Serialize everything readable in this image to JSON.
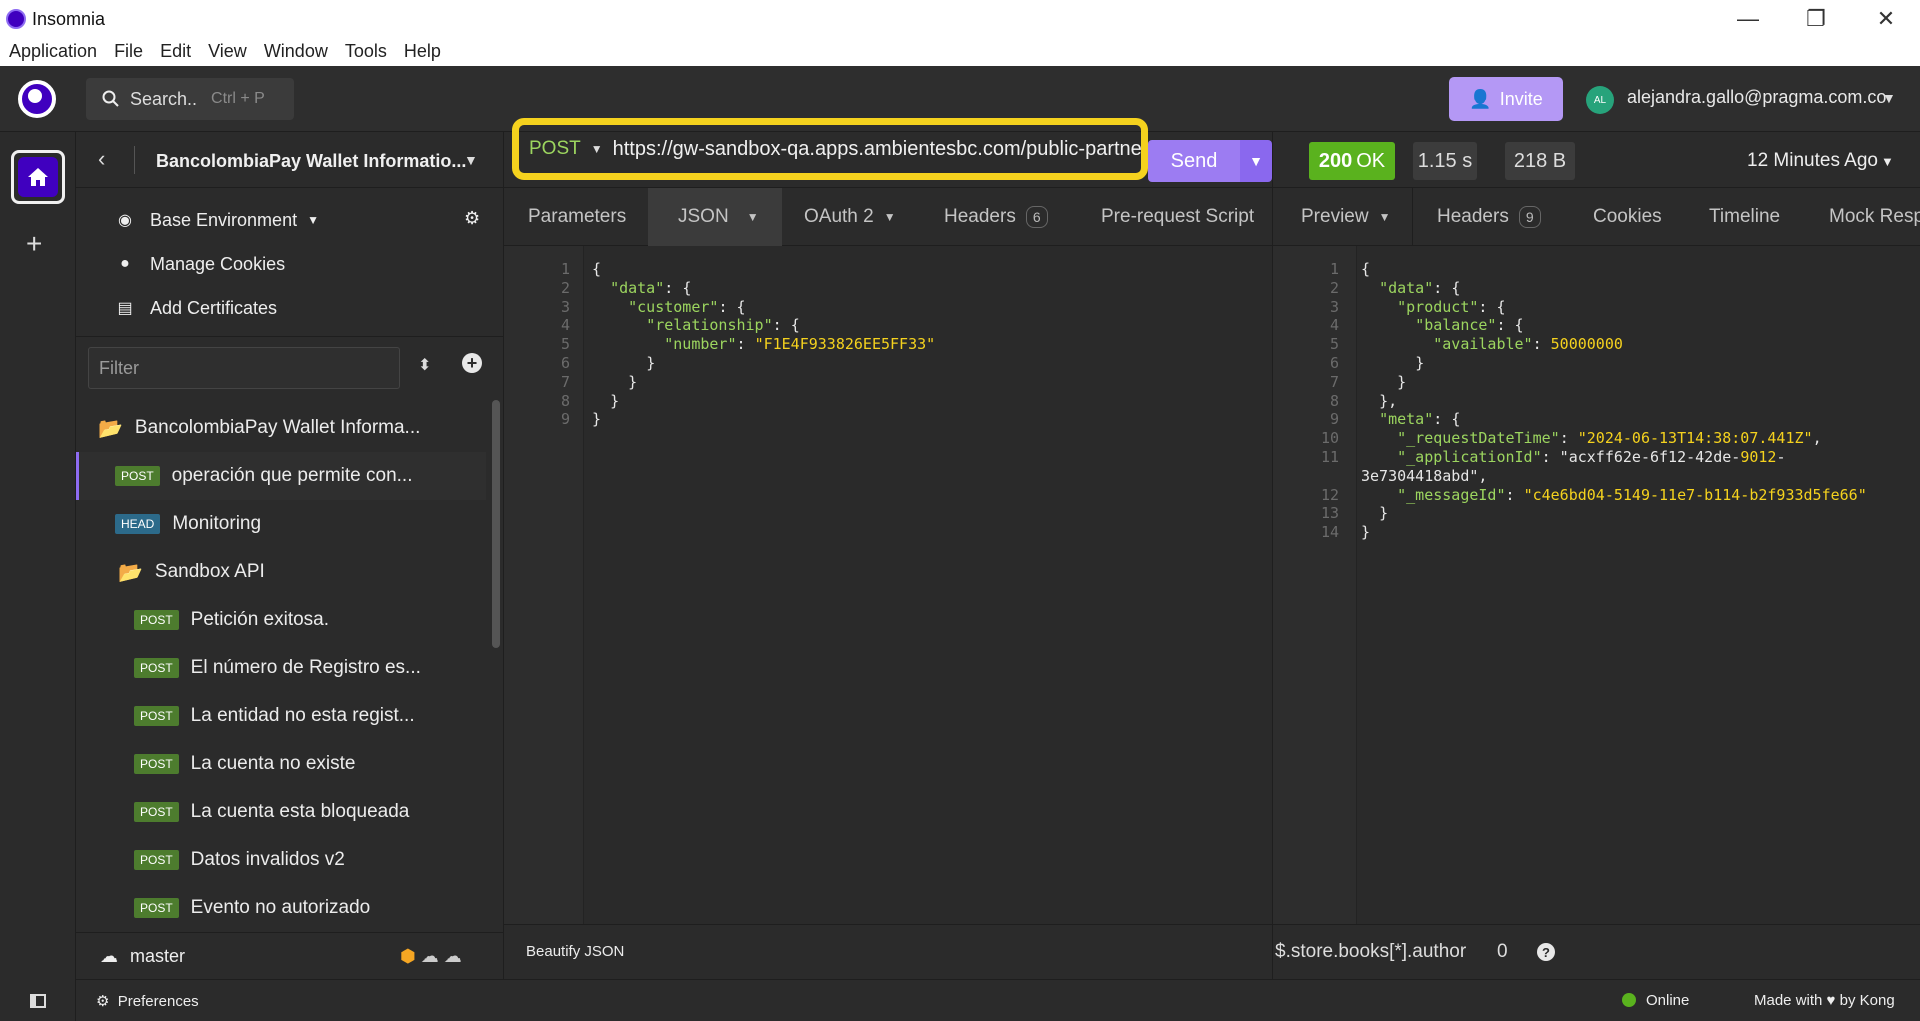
{
  "window": {
    "title": "Insomnia",
    "controls": {
      "minimize": "—",
      "restore": "❐",
      "close": "✕"
    }
  },
  "menu": [
    "Application",
    "File",
    "Edit",
    "View",
    "Window",
    "Tools",
    "Help"
  ],
  "topbar": {
    "search_label": "Search..",
    "search_shortcut": "Ctrl + P",
    "invite_label": "Invite",
    "avatar_initials": "AL",
    "user_email": "alejandra.gallo@pragma.com.co"
  },
  "sidebar": {
    "workspace_name": "BancolombiaPay Wallet Informatio...",
    "environment": "Base Environment",
    "manage_cookies": "Manage Cookies",
    "add_certificates": "Add Certificates",
    "filter_placeholder": "Filter",
    "items": [
      {
        "type": "folder",
        "label": "BancolombiaPay Wallet Informa..."
      },
      {
        "type": "request",
        "method": "POST",
        "label": "operación que permite con..."
      },
      {
        "type": "request",
        "method": "HEAD",
        "label": "Monitoring"
      },
      {
        "type": "folder",
        "label": "Sandbox API"
      },
      {
        "type": "request",
        "method": "POST",
        "label": "Petición exitosa."
      },
      {
        "type": "request",
        "method": "POST",
        "label": "El número de Registro es..."
      },
      {
        "type": "request",
        "method": "POST",
        "label": "La entidad no esta regist..."
      },
      {
        "type": "request",
        "method": "POST",
        "label": "La cuenta no existe"
      },
      {
        "type": "request",
        "method": "POST",
        "label": "La cuenta esta bloqueada"
      },
      {
        "type": "request",
        "method": "POST",
        "label": "Datos invalidos v2"
      },
      {
        "type": "request",
        "method": "POST",
        "label": "Evento no autorizado"
      }
    ],
    "branch": "master"
  },
  "request": {
    "method": "POST",
    "url": "https://gw-sandbox-qa.apps.ambientesbc.com/public-partne",
    "send_label": "Send",
    "tabs": {
      "parameters": "Parameters",
      "json": "JSON",
      "oauth": "OAuth 2",
      "headers": "Headers",
      "headers_count": "6",
      "prerequest": "Pre-request Script"
    },
    "body_lines": [
      {
        "n": "1",
        "t": "{"
      },
      {
        "n": "2",
        "t": "  \"data\": {"
      },
      {
        "n": "3",
        "t": "    \"customer\": {"
      },
      {
        "n": "4",
        "t": "      \"relationship\": {"
      },
      {
        "n": "5",
        "t": "        \"number\": \"F1E4F933826EE5FF33\""
      },
      {
        "n": "6",
        "t": "      }"
      },
      {
        "n": "7",
        "t": "    }"
      },
      {
        "n": "8",
        "t": "  }"
      },
      {
        "n": "9",
        "t": "}"
      }
    ],
    "beautify_label": "Beautify JSON"
  },
  "response": {
    "status_code": "200",
    "status_text": "OK",
    "time": "1.15 s",
    "size": "218 B",
    "age": "12 Minutes Ago",
    "tabs": {
      "preview": "Preview",
      "headers": "Headers",
      "headers_count": "9",
      "cookies": "Cookies",
      "timeline": "Timeline",
      "mock": "Mock Resp"
    },
    "body_lines": [
      {
        "n": "1",
        "t": "{"
      },
      {
        "n": "2",
        "t": "  \"data\": {"
      },
      {
        "n": "3",
        "t": "    \"product\": {"
      },
      {
        "n": "4",
        "t": "      \"balance\": {"
      },
      {
        "n": "5",
        "t": "        \"available\": 50000000"
      },
      {
        "n": "6",
        "t": "      }"
      },
      {
        "n": "7",
        "t": "    }"
      },
      {
        "n": "8",
        "t": "  },"
      },
      {
        "n": "9",
        "t": "  \"meta\": {"
      },
      {
        "n": "10",
        "t": "    \"_requestDateTime\": \"2024-06-13T14:38:07.441Z\","
      },
      {
        "n": "11",
        "t": "    \"_applicationId\": \"acxff62e-6f12-42de-9012-"
      },
      {
        "n": "",
        "t": "3e7304418abd\","
      },
      {
        "n": "12",
        "t": "    \"_messageId\": \"c4e6bd04-5149-11e7-b114-b2f933d5fe66\""
      },
      {
        "n": "13",
        "t": "  }"
      },
      {
        "n": "14",
        "t": "}"
      }
    ],
    "filter_query": "$.store.books[*].author",
    "filter_count": "0"
  },
  "statusbar": {
    "preferences": "Preferences",
    "online": "Online",
    "made_with": "Made with",
    "by": "by Kong"
  },
  "colors": {
    "accent": "#4000bf",
    "send": "#9c7cf2",
    "status_ok": "#5ab21e",
    "highlight": "#f5d21e"
  }
}
